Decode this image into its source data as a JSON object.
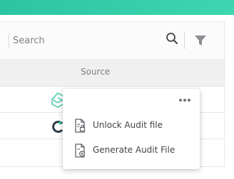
{
  "colors": {
    "accent": "#2cc5a2",
    "text": "#3f4448",
    "muted": "#7b7f84"
  },
  "search": {
    "placeholder": "Search",
    "search_icon": "search-icon",
    "filter_icon": "filter-icon"
  },
  "table": {
    "columns": [
      "Source"
    ],
    "rows": [
      {
        "source_icon": "s-logo-icon"
      },
      {
        "source_icon": "c-logo-icon"
      },
      {
        "source_icon": ""
      }
    ]
  },
  "context_menu": {
    "more_icon": "more-horizontal-icon",
    "items": [
      {
        "label": "Unlock Audit file",
        "icon": "file-lock-icon"
      },
      {
        "label": "Generate Audit File",
        "icon": "file-generate-icon"
      }
    ]
  }
}
